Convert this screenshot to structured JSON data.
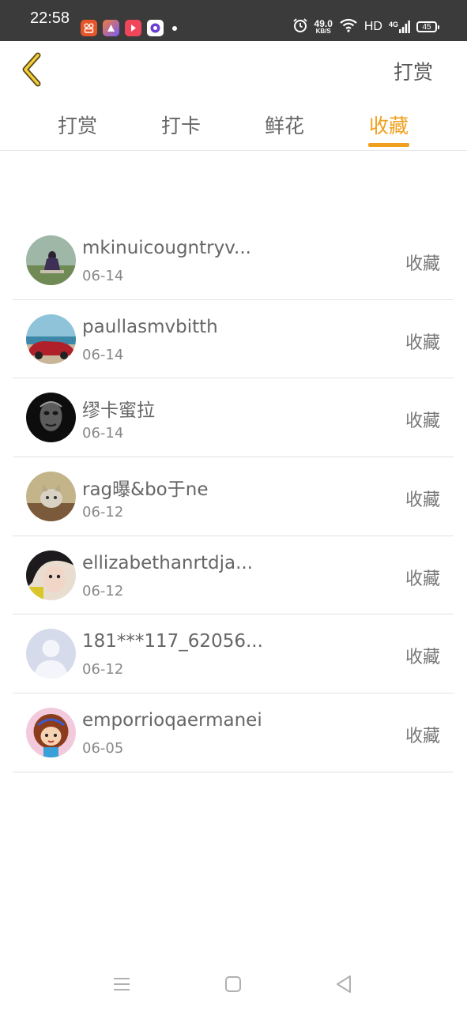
{
  "status_bar": {
    "time": "22:58",
    "speed_value": "49.0",
    "speed_unit": "KB/S",
    "hd": "HD",
    "network": "4G",
    "battery": "45"
  },
  "header": {
    "back_icon": "chevron-left-icon",
    "action_label": "打赏"
  },
  "tabs": [
    {
      "label": "打赏",
      "active": false
    },
    {
      "label": "打卡",
      "active": false
    },
    {
      "label": "鲜花",
      "active": false
    },
    {
      "label": "收藏",
      "active": true
    }
  ],
  "colors": {
    "accent": "#f0a01e",
    "status_bar": "#3b3b3b"
  },
  "list": [
    {
      "name": "mkinuicougntryv...",
      "date": "06-14",
      "type": "收藏"
    },
    {
      "name": "paullasmvbitth",
      "date": "06-14",
      "type": "收藏"
    },
    {
      "name": "缪卡蜜拉",
      "date": "06-14",
      "type": "收藏"
    },
    {
      "name": "rag曝&bo于ne",
      "date": "06-12",
      "type": "收藏"
    },
    {
      "name": "ellizabethanrtdja...",
      "date": "06-12",
      "type": "收藏"
    },
    {
      "name": "181***117_62056...",
      "date": "06-12",
      "type": "收藏"
    },
    {
      "name": "emporrioqaermanei",
      "date": "06-05",
      "type": "收藏"
    }
  ],
  "navbar": {
    "menu_icon": "menu-icon",
    "home_icon": "home-square-icon",
    "back_icon": "back-triangle-icon"
  }
}
